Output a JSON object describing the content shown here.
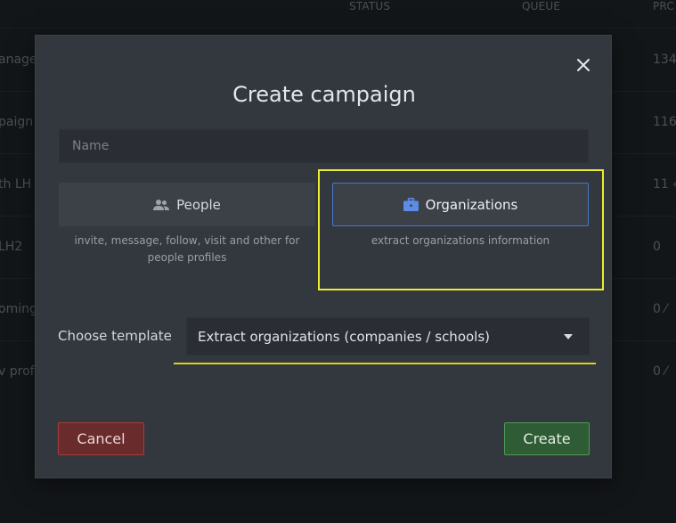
{
  "background": {
    "columns": [
      "STATUS",
      "QUEUE",
      "PRC"
    ],
    "rows": [
      {
        "name": "anage",
        "value": "134"
      },
      {
        "name": "paign",
        "value": "116"
      },
      {
        "name": "th LH",
        "value": "11 ‹"
      },
      {
        "name": "LH2",
        "value": "0"
      },
      {
        "name": "oming",
        "value": "0 ⁄"
      },
      {
        "name": "v prof",
        "value": "0 ⁄"
      }
    ]
  },
  "modal": {
    "title": "Create campaign",
    "name_placeholder": "Name",
    "name_value": "",
    "types": {
      "people": {
        "label": "People",
        "icon": "people-icon",
        "description": "invite, message, follow, visit and other for people profiles"
      },
      "organizations": {
        "label": "Organizations",
        "icon": "briefcase-icon",
        "description": "extract organizations information",
        "selected": true
      }
    },
    "template_label": "Choose template",
    "template_value": "Extract organizations (companies / schools)",
    "cancel_label": "Cancel",
    "create_label": "Create"
  },
  "colors": {
    "accent_blue": "#4a78c9",
    "highlight_yellow": "#ecec33",
    "cancel_red": "#a83c3c",
    "create_green": "#4c9a55"
  }
}
